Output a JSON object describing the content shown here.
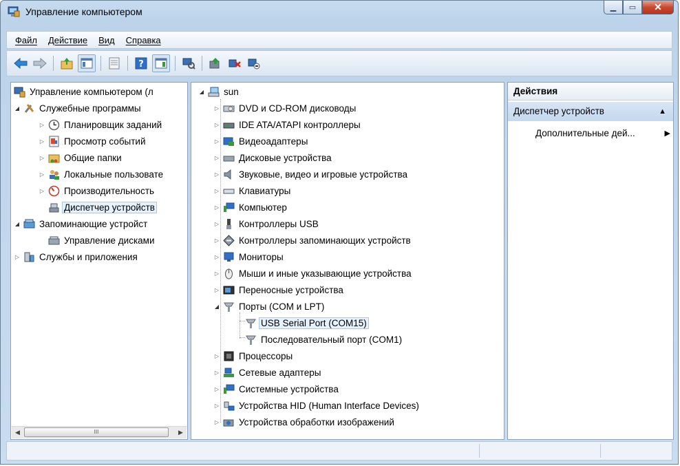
{
  "window": {
    "title": "Управление компьютером"
  },
  "menu": {
    "file": "Файл",
    "action": "Действие",
    "view": "Вид",
    "help": "Справка"
  },
  "left_tree": {
    "root": "Управление компьютером (л",
    "items": [
      {
        "label": "Служебные программы"
      },
      {
        "label": "Планировщик заданий"
      },
      {
        "label": "Просмотр событий"
      },
      {
        "label": "Общие папки"
      },
      {
        "label": "Локальные пользовате"
      },
      {
        "label": "Производительность"
      },
      {
        "label": "Диспетчер устройств"
      },
      {
        "label": "Запоминающие устройст"
      },
      {
        "label": "Управление дисками"
      },
      {
        "label": "Службы и приложения"
      }
    ],
    "scroll_thumb": "III"
  },
  "device_tree": {
    "root": "sun",
    "items": [
      {
        "label": "DVD и CD-ROM дисководы"
      },
      {
        "label": "IDE ATA/ATAPI контроллеры"
      },
      {
        "label": "Видеоадаптеры"
      },
      {
        "label": "Дисковые устройства"
      },
      {
        "label": "Звуковые, видео и игровые устройства"
      },
      {
        "label": "Клавиатуры"
      },
      {
        "label": "Компьютер"
      },
      {
        "label": "Контроллеры USB"
      },
      {
        "label": "Контроллеры запоминающих устройств"
      },
      {
        "label": "Мониторы"
      },
      {
        "label": "Мыши и иные указывающие устройства"
      },
      {
        "label": "Переносные устройства"
      },
      {
        "label": "Порты (COM и LPT)"
      },
      {
        "label": "USB Serial Port (COM15)"
      },
      {
        "label": "Последовательный порт (COM1)"
      },
      {
        "label": "Процессоры"
      },
      {
        "label": "Сетевые адаптеры"
      },
      {
        "label": "Системные устройства"
      },
      {
        "label": "Устройства HID (Human Interface Devices)"
      },
      {
        "label": "Устройства обработки изображений"
      }
    ]
  },
  "actions": {
    "header": "Действия",
    "section": "Диспетчер устройств",
    "more": "Дополнительные дей..."
  },
  "colors": {
    "selection_bg": "#e5f1fb",
    "selection_border": "#a7c9ea",
    "window_frame": "#bcd3ea"
  },
  "icons": {
    "toolbar": [
      "back-arrow-icon",
      "forward-arrow-icon",
      "up-folder-icon",
      "show-tree-icon",
      "properties-icon",
      "help-icon",
      "action-pane-icon",
      "scan-hardware-icon",
      "update-driver-icon",
      "disable-device-icon",
      "uninstall-device-icon"
    ]
  }
}
